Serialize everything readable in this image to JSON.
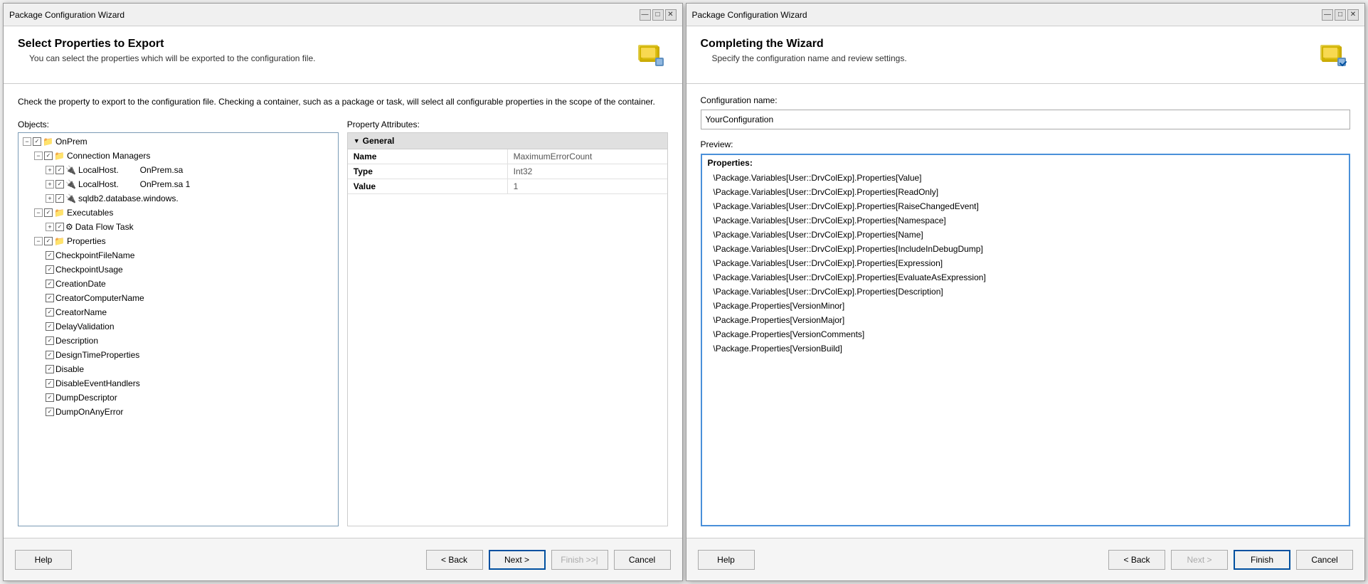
{
  "window1": {
    "title": "Package Configuration Wizard",
    "header": {
      "title": "Select Properties to Export",
      "subtitle": "You can select the properties which will be exported to the configuration file."
    },
    "description": "Check the property to export to the configuration file. Checking a container, such as a package or task, will select all configurable properties in the scope of the container.",
    "objects_label": "Objects:",
    "property_label": "Property Attributes:",
    "tree_items": [
      {
        "indent": 1,
        "text": "OnPrem",
        "has_expand": true,
        "has_checkbox": true,
        "checked": true
      },
      {
        "indent": 2,
        "text": "Connection Managers",
        "has_expand": true,
        "has_checkbox": true,
        "checked": true
      },
      {
        "indent": 3,
        "text": "LocalHost.         OnPrem.sa",
        "has_expand": true,
        "has_checkbox": true,
        "checked": true
      },
      {
        "indent": 3,
        "text": "LocalHost.         OnPrem.sa 1",
        "has_expand": true,
        "has_checkbox": true,
        "checked": true
      },
      {
        "indent": 3,
        "text": "sqldb2.database.windows.",
        "has_expand": true,
        "has_checkbox": true,
        "checked": true
      },
      {
        "indent": 2,
        "text": "Executables",
        "has_expand": true,
        "has_checkbox": true,
        "checked": true
      },
      {
        "indent": 3,
        "text": "Data Flow Task",
        "has_expand": true,
        "has_checkbox": true,
        "checked": true
      },
      {
        "indent": 2,
        "text": "Properties",
        "has_expand": true,
        "has_checkbox": true,
        "checked": true
      },
      {
        "indent": 3,
        "text": "CheckpointFileName",
        "has_expand": false,
        "has_checkbox": true,
        "checked": true
      },
      {
        "indent": 3,
        "text": "CheckpointUsage",
        "has_expand": false,
        "has_checkbox": true,
        "checked": true
      },
      {
        "indent": 3,
        "text": "CreationDate",
        "has_expand": false,
        "has_checkbox": true,
        "checked": true
      },
      {
        "indent": 3,
        "text": "CreatorComputerName",
        "has_expand": false,
        "has_checkbox": true,
        "checked": true
      },
      {
        "indent": 3,
        "text": "CreatorName",
        "has_expand": false,
        "has_checkbox": true,
        "checked": true
      },
      {
        "indent": 3,
        "text": "DelayValidation",
        "has_expand": false,
        "has_checkbox": true,
        "checked": true
      },
      {
        "indent": 3,
        "text": "Description",
        "has_expand": false,
        "has_checkbox": true,
        "checked": true
      },
      {
        "indent": 3,
        "text": "DesignTimeProperties",
        "has_expand": false,
        "has_checkbox": true,
        "checked": true
      },
      {
        "indent": 3,
        "text": "Disable",
        "has_expand": false,
        "has_checkbox": true,
        "checked": true
      },
      {
        "indent": 3,
        "text": "DisableEventHandlers",
        "has_expand": false,
        "has_checkbox": true,
        "checked": true
      },
      {
        "indent": 3,
        "text": "DumpDescriptor",
        "has_expand": false,
        "has_checkbox": true,
        "checked": true
      },
      {
        "indent": 3,
        "text": "DumpOnAnyError",
        "has_expand": false,
        "has_checkbox": true,
        "checked": true
      }
    ],
    "property_table": {
      "header": "General",
      "rows": [
        {
          "name": "Name",
          "value": "MaximumErrorCount"
        },
        {
          "name": "Type",
          "value": "Int32"
        },
        {
          "name": "Value",
          "value": "1"
        }
      ]
    },
    "footer": {
      "help": "Help",
      "back": "< Back",
      "next": "Next >",
      "finish": "Finish >>|",
      "cancel": "Cancel"
    }
  },
  "window2": {
    "title": "Package Configuration Wizard",
    "header": {
      "title": "Completing the Wizard",
      "subtitle": "Specify the configuration name and review settings."
    },
    "config_name_label": "Configuration name:",
    "config_name_value": "YourConfiguration",
    "preview_label": "Preview:",
    "preview_properties_header": "Properties:",
    "preview_items": [
      "\\Package.Variables[User::DrvColExp].Properties[Value]",
      "\\Package.Variables[User::DrvColExp].Properties[ReadOnly]",
      "\\Package.Variables[User::DrvColExp].Properties[RaiseChangedEvent]",
      "\\Package.Variables[User::DrvColExp].Properties[Namespace]",
      "\\Package.Variables[User::DrvColExp].Properties[Name]",
      "\\Package.Variables[User::DrvColExp].Properties[IncludeInDebugDump]",
      "\\Package.Variables[User::DrvColExp].Properties[Expression]",
      "\\Package.Variables[User::DrvColExp].Properties[EvaluateAsExpression]",
      "\\Package.Variables[User::DrvColExp].Properties[Description]",
      "\\Package.Properties[VersionMinor]",
      "\\Package.Properties[VersionMajor]",
      "\\Package.Properties[VersionComments]",
      "\\Package.Properties[VersionBuild]"
    ],
    "footer": {
      "help": "Help",
      "back": "< Back",
      "next": "Next >",
      "finish": "Finish",
      "cancel": "Cancel"
    }
  }
}
